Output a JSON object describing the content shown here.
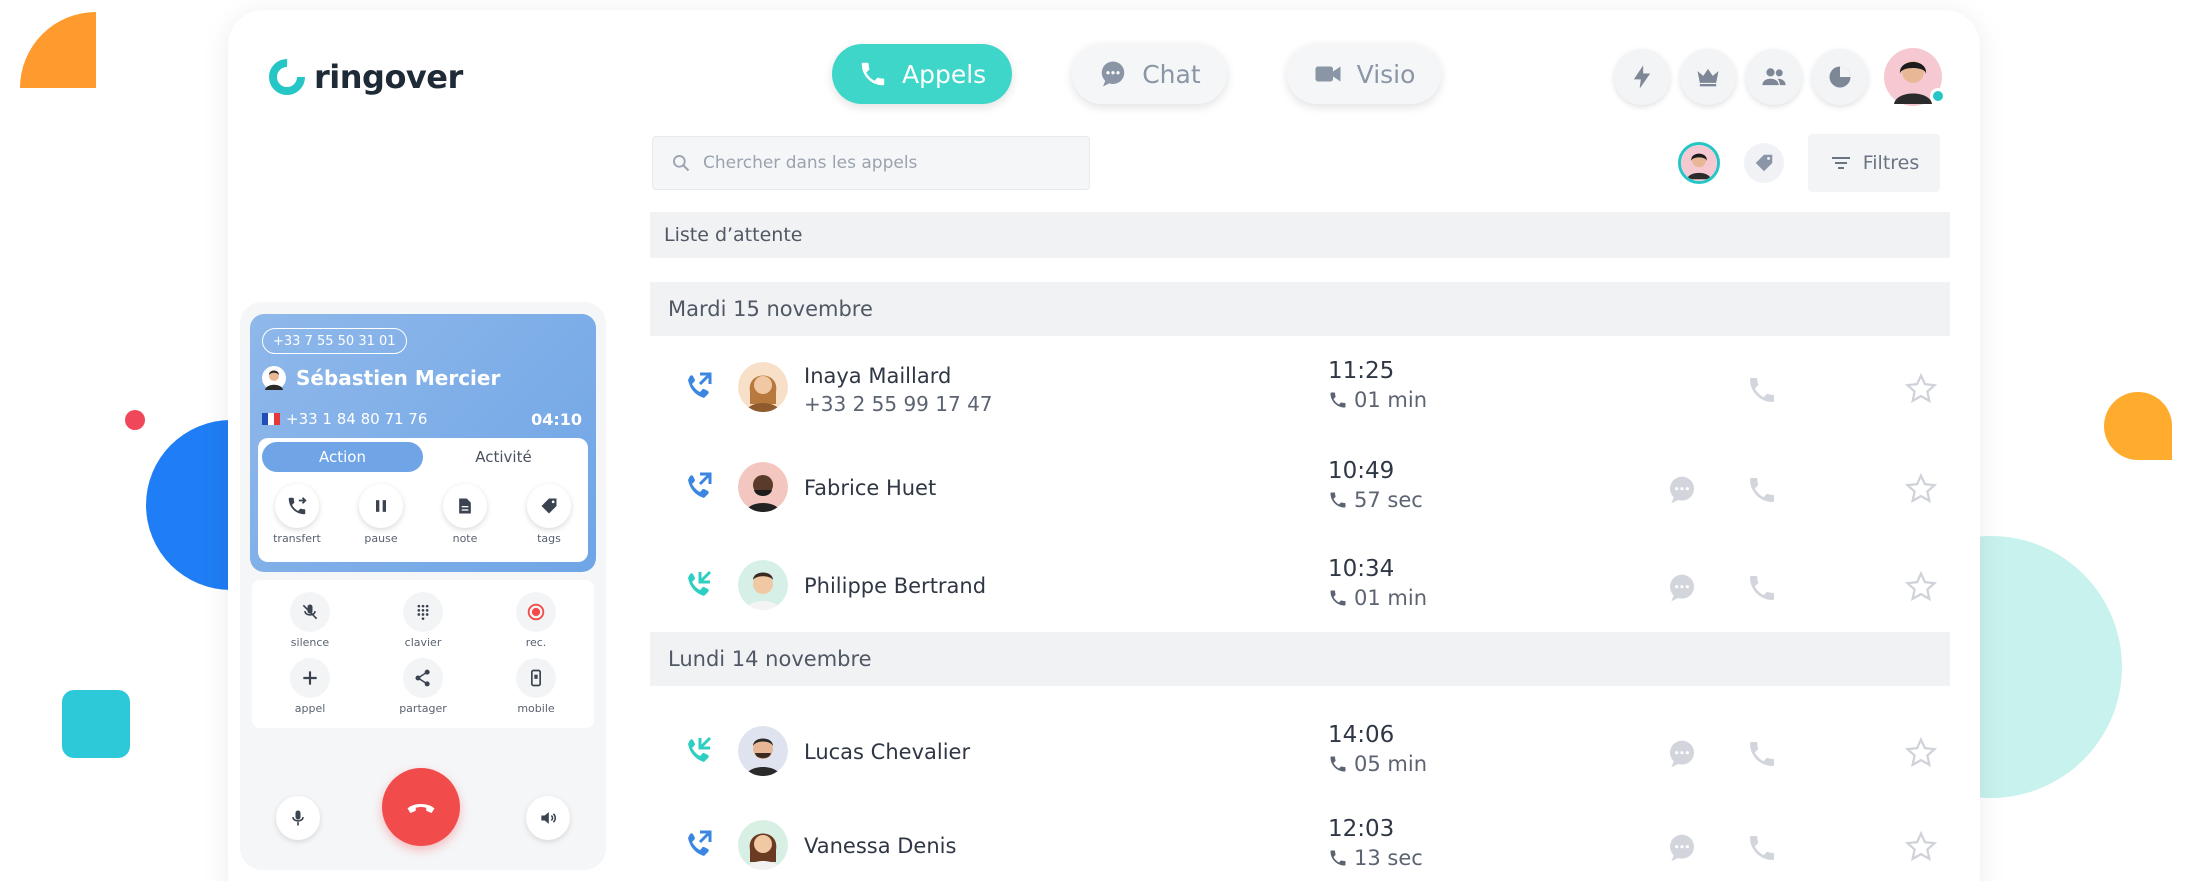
{
  "brand": {
    "name": "ringover"
  },
  "tabs": [
    {
      "label": "Appels",
      "icon": "phone-icon",
      "active": true
    },
    {
      "label": "Chat",
      "icon": "chat-bubble-icon",
      "active": false
    },
    {
      "label": "Visio",
      "icon": "video-icon",
      "active": false
    }
  ],
  "top_icons": [
    "lightning-icon",
    "crown-icon",
    "users-icon",
    "pie-chart-icon"
  ],
  "search": {
    "placeholder": "Chercher dans les appels"
  },
  "filters": {
    "label": "Filtres"
  },
  "waitlist": {
    "label": "Liste d’attente"
  },
  "days": [
    {
      "label": "Mardi 15 novembre",
      "calls": [
        {
          "name": "Inaya Maillard",
          "number": "+33 2 55 99 17 47",
          "time": "11:25",
          "duration": "01 min",
          "direction": "outgoing",
          "has_chat": false
        },
        {
          "name": "Fabrice Huet",
          "number": "",
          "time": "10:49",
          "duration": "57 sec",
          "direction": "outgoing",
          "has_chat": true
        },
        {
          "name": "Philippe Bertrand",
          "number": "",
          "time": "10:34",
          "duration": "01 min",
          "direction": "incoming",
          "has_chat": true
        }
      ]
    },
    {
      "label": "Lundi 14 novembre",
      "calls": [
        {
          "name": "Lucas Chevalier",
          "number": "",
          "time": "14:06",
          "duration": "05 min",
          "direction": "incoming",
          "has_chat": true
        },
        {
          "name": "Vanessa Denis",
          "number": "",
          "time": "12:03",
          "duration": "13 sec",
          "direction": "outgoing",
          "has_chat": true
        }
      ]
    }
  ],
  "phone": {
    "dialed_number": "+33 7 55 50 31 01",
    "caller_name": "Sébastien Mercier",
    "caller_number": "+33 1 84 80 71 76",
    "timer": "04:10",
    "segments": [
      "Action",
      "Activité"
    ],
    "actions": [
      "transfert",
      "pause",
      "note",
      "tags"
    ],
    "controls": [
      "silence",
      "clavier",
      "rec.",
      "appel",
      "partager",
      "mobile"
    ]
  },
  "colors": {
    "accent": "#3ed6c9",
    "call_card": "#7aaee8",
    "hangup": "#f24b4b",
    "deco_orange": "#ff9a2e",
    "deco_blue": "#1f7ef5",
    "deco_teal": "#2ec9d8"
  }
}
